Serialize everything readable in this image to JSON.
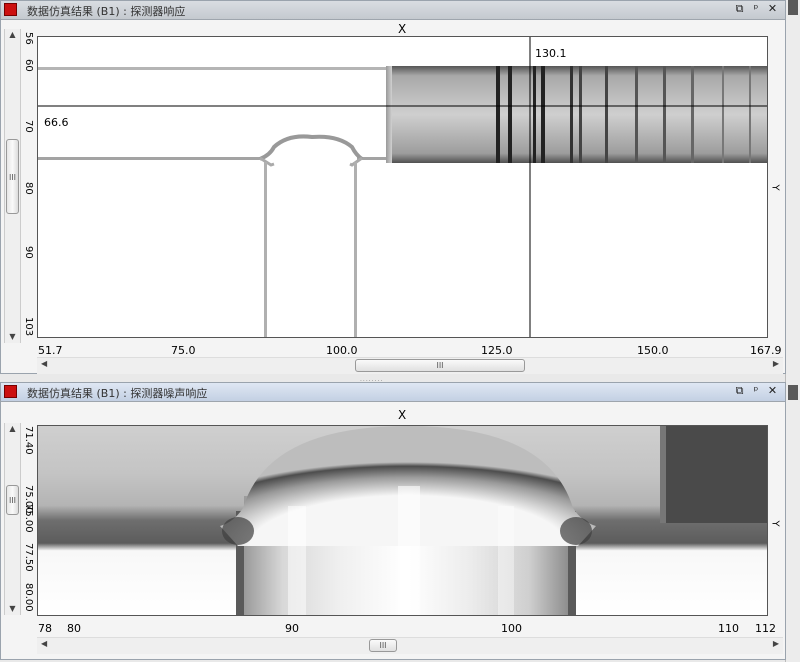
{
  "top_window": {
    "title": "数据仿真结果 (B1) : 探测器响应",
    "controls": [
      "⧉",
      "ᵖ",
      "✕"
    ],
    "axis_x_name": "X",
    "axis_y_name": "Y",
    "x_ticks": [
      "51.7",
      "75.0",
      "100.0",
      "125.0",
      "150.0",
      "167.9"
    ],
    "y_ticks": [
      "56",
      "60",
      "70",
      "80",
      "90",
      "103"
    ],
    "crosshair_x_label": "130.1",
    "crosshair_y_label": "66.6",
    "hscroll_grip": "III",
    "vscroll_grip": "III"
  },
  "bottom_window": {
    "title": "数据仿真结果 (B1) : 探测器噪声响应",
    "controls": [
      "⧉",
      "ᵖ",
      "✕"
    ],
    "axis_x_name": "X",
    "axis_y_name": "Y",
    "x_ticks": [
      "78",
      "80",
      "90",
      "100",
      "110",
      "112"
    ],
    "y_ticks": [
      "71.40",
      "75.00",
      "75.00",
      "77.50",
      "80.00"
    ],
    "hscroll_grip": "III",
    "vscroll_grip": "III"
  },
  "splitter_grip": "........"
}
